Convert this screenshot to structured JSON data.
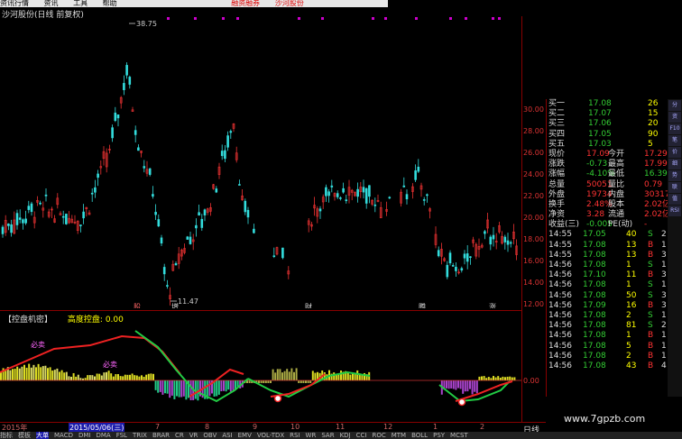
{
  "menu": {
    "items": [
      "资讯",
      "工具",
      "帮助"
    ],
    "first": "资讯行情",
    "hot1": "融资融券",
    "hot2": "沙河股份"
  },
  "chart_title": "沙河股份(日线 前复权)",
  "price_axis": [
    "30.00",
    "28.00",
    "26.00",
    "24.00",
    "22.00",
    "20.00",
    "18.00",
    "16.00",
    "14.00",
    "12.00"
  ],
  "high_label": "38.75",
  "low_label": "11.47",
  "event_marks": [
    "股",
    "增",
    "财",
    "腾",
    "涨"
  ],
  "indicator": {
    "title": "【控盘机密】",
    "label": "高度控盘:",
    "value": "0.00",
    "axis_zero": "0.00",
    "markers": [
      "必卖",
      "必卖"
    ]
  },
  "dates": {
    "year": "2015年",
    "selected": "2015/05/06(三)",
    "months": [
      "7",
      "8",
      "9",
      "10",
      "11",
      "12",
      "1",
      "2"
    ],
    "period": "日线"
  },
  "quote_panel": {
    "asks": [
      {
        "label": "买一",
        "price": "17.08",
        "vol": "26"
      },
      {
        "label": "买二",
        "price": "17.07",
        "vol": "15"
      },
      {
        "label": "买三",
        "price": "17.06",
        "vol": "20"
      },
      {
        "label": "买四",
        "price": "17.05",
        "vol": "90"
      },
      {
        "label": "买五",
        "price": "17.03",
        "vol": "5"
      }
    ],
    "stats": [
      {
        "l1": "现价",
        "v1": "17.09",
        "l2": "今开",
        "v2": "17.29"
      },
      {
        "l1": "涨跌",
        "v1": "-0.73",
        "l2": "最高",
        "v2": "17.99"
      },
      {
        "l1": "涨幅",
        "v1": "-4.10%",
        "l2": "最低",
        "v2": "16.39"
      },
      {
        "l1": "总量",
        "v1": "50051",
        "l2": "量比",
        "v2": "0.79"
      },
      {
        "l1": "外盘",
        "v1": "19734",
        "l2": "内盘",
        "v2": "30317"
      },
      {
        "l1": "换手",
        "v1": "2.48%",
        "l2": "股本",
        "v2": "2.02亿"
      },
      {
        "l1": "净资",
        "v1": "3.28",
        "l2": "流通",
        "v2": "2.02亿"
      },
      {
        "l1": "收益(三)",
        "v1": "-0.005",
        "l2": "PE(动)",
        "v2": "-"
      }
    ],
    "ticks": [
      {
        "time": "14:55",
        "price": "17.05",
        "vol": "40",
        "dir": "S",
        "n": "2"
      },
      {
        "time": "14:55",
        "price": "17.08",
        "vol": "13",
        "dir": "B",
        "n": "1"
      },
      {
        "time": "14:55",
        "price": "17.08",
        "vol": "13",
        "dir": "B",
        "n": "3"
      },
      {
        "time": "14:56",
        "price": "17.08",
        "vol": "1",
        "dir": "S",
        "n": "1"
      },
      {
        "time": "14:56",
        "price": "17.10",
        "vol": "11",
        "dir": "B",
        "n": "3"
      },
      {
        "time": "14:56",
        "price": "17.08",
        "vol": "1",
        "dir": "S",
        "n": "1"
      },
      {
        "time": "14:56",
        "price": "17.08",
        "vol": "50",
        "dir": "S",
        "n": "3"
      },
      {
        "time": "14:56",
        "price": "17.09",
        "vol": "16",
        "dir": "B",
        "n": "3"
      },
      {
        "time": "14:56",
        "price": "17.08",
        "vol": "2",
        "dir": "S",
        "n": "1"
      },
      {
        "time": "14:56",
        "price": "17.08",
        "vol": "81",
        "dir": "S",
        "n": "2"
      },
      {
        "time": "14:56",
        "price": "17.08",
        "vol": "1",
        "dir": "B",
        "n": "1"
      },
      {
        "time": "14:56",
        "price": "17.08",
        "vol": "5",
        "dir": "B",
        "n": "1"
      },
      {
        "time": "14:56",
        "price": "17.08",
        "vol": "2",
        "dir": "B",
        "n": "1"
      },
      {
        "time": "14:56",
        "price": "17.08",
        "vol": "43",
        "dir": "B",
        "n": "4"
      }
    ]
  },
  "bottom_tabs": [
    "指标",
    "模板",
    "大单",
    "MACD",
    "DMI",
    "DMA",
    "FSL",
    "TRIX",
    "BRAR",
    "CR",
    "VR",
    "OBV",
    "ASI",
    "EMV",
    "VOL-TDX",
    "RSI",
    "WR",
    "SAR",
    "KDJ",
    "CCI",
    "ROC",
    "MTM",
    "BOLL",
    "PSY",
    "MCST"
  ],
  "right_strip": [
    "分",
    "资",
    "F10",
    "笔",
    "价",
    "细",
    "势",
    "联",
    "值",
    "RSI"
  ],
  "watermark": "www.7gpzb.com"
}
